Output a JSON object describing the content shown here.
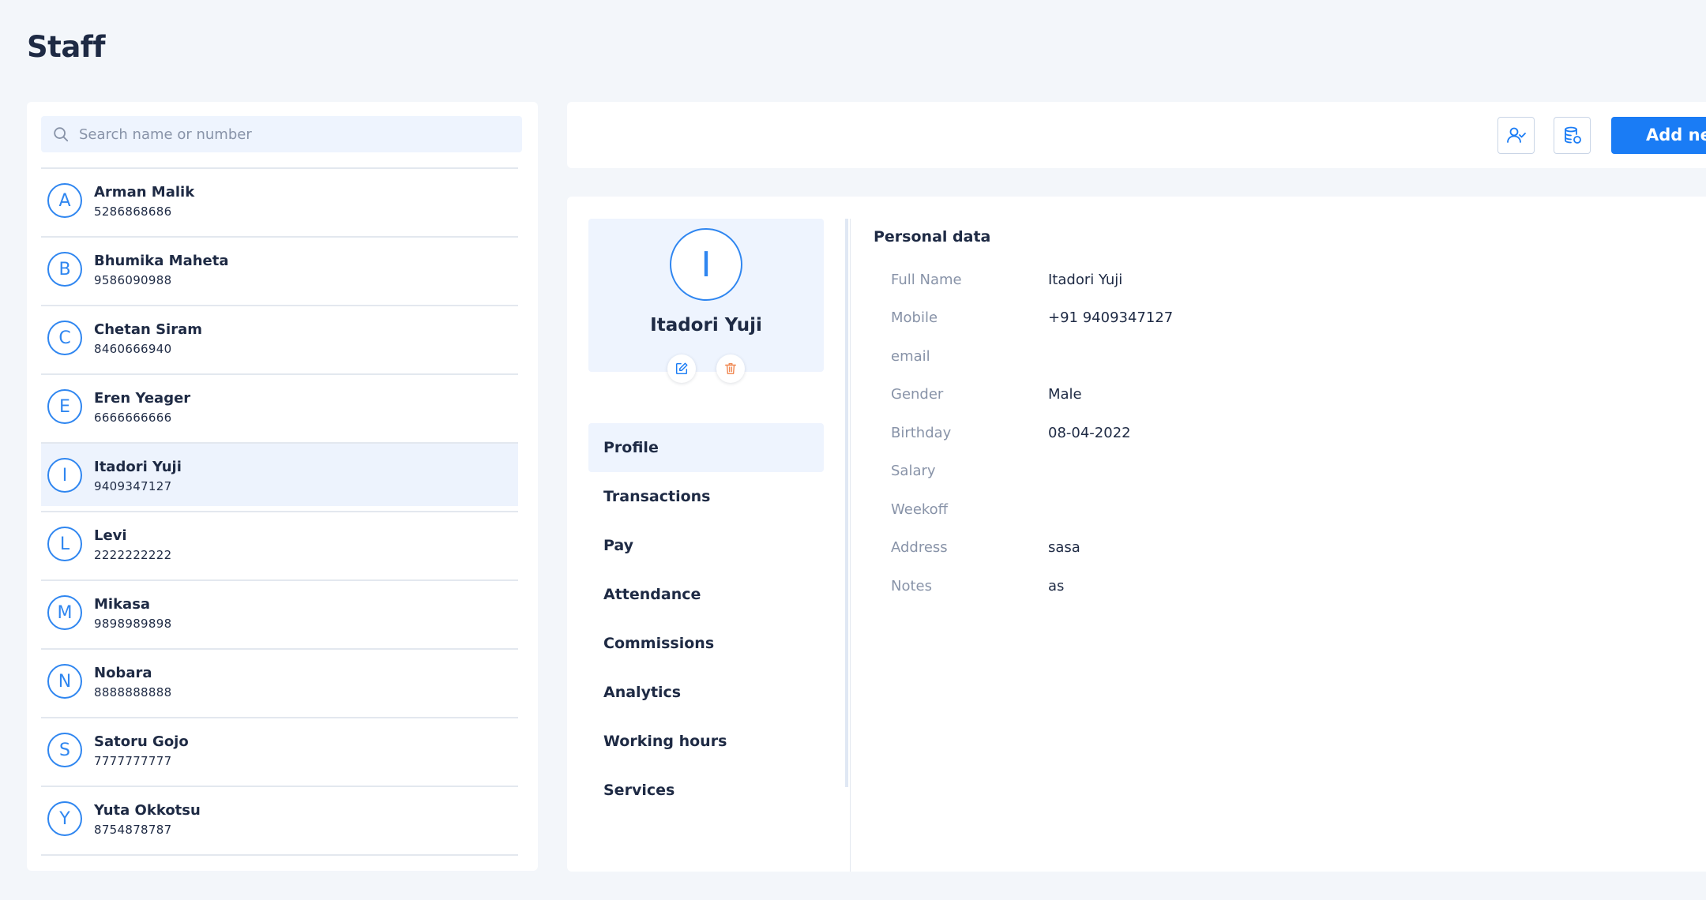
{
  "page": {
    "title": "Staff"
  },
  "search": {
    "placeholder": "Search name or number"
  },
  "staff": [
    {
      "initial": "A",
      "name": "Arman Malik",
      "phone": "5286868686"
    },
    {
      "initial": "B",
      "name": "Bhumika Maheta",
      "phone": "9586090988"
    },
    {
      "initial": "C",
      "name": "Chetan Siram",
      "phone": "8460666940"
    },
    {
      "initial": "E",
      "name": "Eren Yeager",
      "phone": "6666666666"
    },
    {
      "initial": "I",
      "name": "Itadori Yuji",
      "phone": "9409347127",
      "selected": true
    },
    {
      "initial": "L",
      "name": "Levi",
      "phone": "2222222222"
    },
    {
      "initial": "M",
      "name": "Mikasa",
      "phone": "9898989898"
    },
    {
      "initial": "N",
      "name": "Nobara",
      "phone": "8888888888"
    },
    {
      "initial": "S",
      "name": "Satoru Gojo",
      "phone": "7777777777"
    },
    {
      "initial": "Y",
      "name": "Yuta Okkotsu",
      "phone": "8754878787"
    }
  ],
  "toolbar": {
    "user_check_icon": "user-check-icon",
    "database_icon": "database-icon",
    "add_label": "Add new"
  },
  "profile": {
    "initial": "I",
    "name": "Itadori Yuji",
    "edit_icon": "edit-icon",
    "delete_icon": "trash-icon"
  },
  "menu": [
    {
      "label": "Profile",
      "active": true
    },
    {
      "label": "Transactions"
    },
    {
      "label": "Pay"
    },
    {
      "label": "Attendance"
    },
    {
      "label": "Commissions"
    },
    {
      "label": "Analytics"
    },
    {
      "label": "Working hours"
    },
    {
      "label": "Services"
    }
  ],
  "personal": {
    "title": "Personal data",
    "fields": [
      {
        "label": "Full Name",
        "value": "Itadori Yuji"
      },
      {
        "label": "Mobile",
        "value": "+91 9409347127"
      },
      {
        "label": "email",
        "value": ""
      },
      {
        "label": "Gender",
        "value": "Male"
      },
      {
        "label": "Birthday",
        "value": "08-04-2022"
      },
      {
        "label": "Salary",
        "value": ""
      },
      {
        "label": "Weekoff",
        "value": ""
      },
      {
        "label": "Address",
        "value": "sasa"
      },
      {
        "label": "Notes",
        "value": "as"
      }
    ]
  },
  "colors": {
    "accent": "#1a7cf5",
    "avatar_border": "#2f86f0",
    "delete": "#f08a55",
    "selected_bg": "#edf3fd"
  }
}
